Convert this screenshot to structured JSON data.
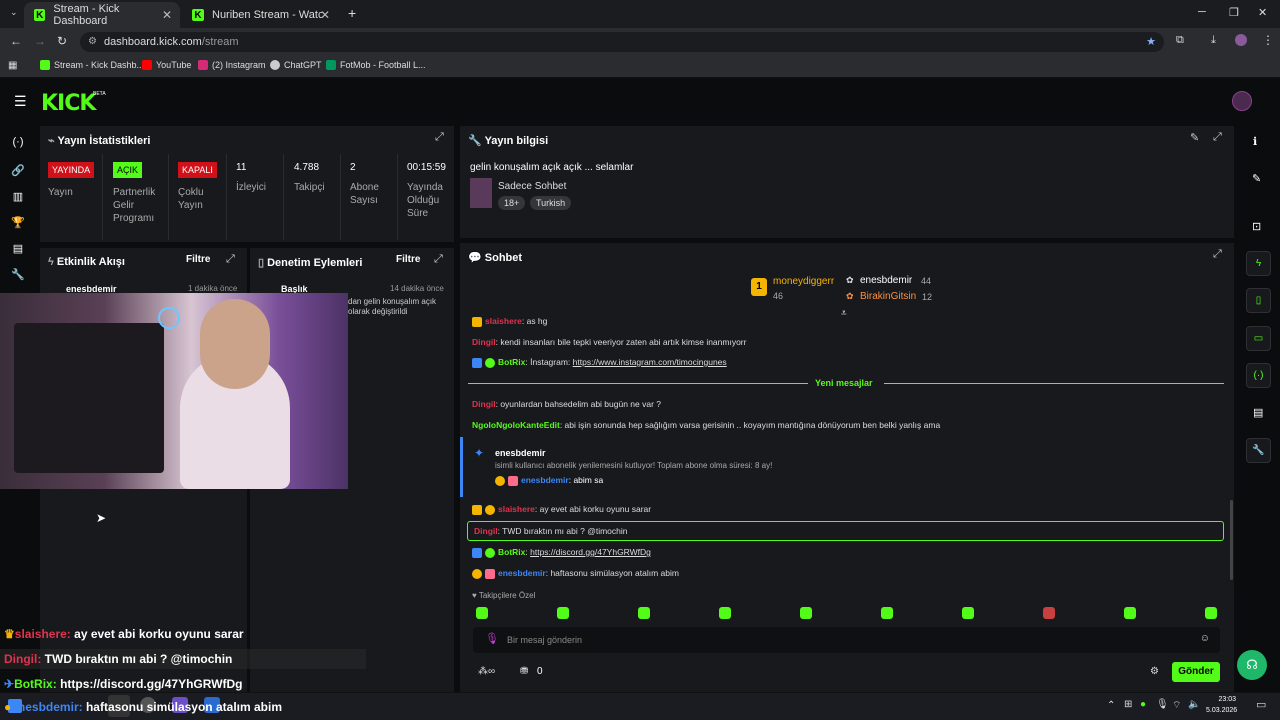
{
  "browser": {
    "tabs": [
      {
        "title": "Stream - Kick Dashboard"
      },
      {
        "title": "Nuriben Stream - Watch Live o"
      }
    ],
    "url_domain": "dashboard.kick.com",
    "url_path": "/stream",
    "bookmarks": [
      {
        "label": "Stream - Kick Dashb...",
        "icon": "kick-icon",
        "color": "#53fc18"
      },
      {
        "label": "YouTube",
        "icon": "youtube-icon",
        "color": "#ff0000"
      },
      {
        "label": "(2) Instagram",
        "icon": "instagram-icon",
        "color": "#d62976"
      },
      {
        "label": "ChatGPT",
        "icon": "chatgpt-icon",
        "color": "#cccccc"
      },
      {
        "label": "FotMob - Football L...",
        "icon": "fotmob-icon",
        "color": "#00985f"
      }
    ]
  },
  "kick": {
    "logo": "KICK",
    "beta": "BETA"
  },
  "stats": {
    "title": "Yayın İstatistikleri",
    "live_badge": "YAYINDA",
    "live_label": "Yayın",
    "partner_badge": "AÇIK",
    "partner_label_1": "Partnerlik",
    "partner_label_2": "Gelir",
    "partner_label_3": "Programı",
    "multi_badge": "KAPALI",
    "multi_label_1": "Çoklu",
    "multi_label_2": "Yayın",
    "viewers_val": "11",
    "viewers_label": "İzleyici",
    "followers_val": "4.788",
    "followers_label": "Takipçi",
    "subs_val": "2",
    "subs_label_1": "Abone",
    "subs_label_2": "Sayısı",
    "uptime_val": "00:15:59",
    "uptime_label_1": "Yayında",
    "uptime_label_2": "Olduğu",
    "uptime_label_3": "Süre"
  },
  "activity": {
    "title": "Etkinlik Akışı",
    "filter": "Filtre",
    "user": "enesbdemir",
    "time": "1 dakika önce"
  },
  "moderation": {
    "title": "Denetim Eylemleri",
    "filter": "Filtre",
    "item_title": "Başlık",
    "time": "14 dakika önce",
    "desc_1": "dan gelin konuşalım açık",
    "desc_2": "olarak değiştirildi"
  },
  "info": {
    "title": "Yayın bilgisi",
    "stream_title": "gelin konuşalım açık açık ... selamlar",
    "category": "Sadece Sohbet",
    "tag_age": "18+",
    "tag_lang": "Turkish"
  },
  "chat": {
    "title": "Sohbet",
    "top1_name": "moneydiggerr",
    "top1_val": "46",
    "top2_name": "enesbdemir",
    "top2_val": "44",
    "top3_name": "BirakinGitsin",
    "top3_val": "12",
    "l0_user": "slaishere",
    "l0_text": ": as hg",
    "l1_user": "Dingil",
    "l1_text": ": kendi insanları bile tepki veeriyor zaten abi artık kimse inanmıyorr",
    "l2_user": "BotRix",
    "l2_text": ": İnstagram: ",
    "l2_link": "https://www.instagram.com/timocingunes",
    "new_msgs": "Yeni mesajlar",
    "l3_user": "Dingil",
    "l3_text": ": oyunlardan bahsedelim abi bugün ne var ?",
    "l4_user": "NgoloNgoloKanteEdit",
    "l4_text": ": abi işin sonunda hep sağlığım varsa gerisinin .. koyayım mantığına dönüyorum ben belki yanlış ama",
    "sub_user": "enesbdemir",
    "sub_text": "isimli kullanıcı abonelik yenilemesini kutluyor! Toplam abone olma süresi: 8 ay!",
    "sub_reply_user": "enesbdemir",
    "sub_reply_text": ": abim sa",
    "l5_user": "slaishere",
    "l5_text": ": ay evet abi korku oyunu sarar",
    "l6_user": "Dingil",
    "l6_text": ": TWD bıraktın mı abi ? @timochin",
    "l7_user": "BotRix",
    "l7_text": ": ",
    "l7_link": "https://discord.gg/47YhGRWfDg",
    "l8_user": "enesbdemir",
    "l8_text": ": haftasonu simülasyon atalım abim",
    "emote_section": "Takipçilere Özel",
    "input_placeholder": "Bir mesaj gönderin",
    "points": "0",
    "send": "Gönder"
  },
  "overlay": {
    "o1_user": "slaishere:",
    "o1_text": " ay evet abi korku oyunu sarar",
    "o2_user": "Dingil:",
    "o2_text": " TWD bıraktın mı abi ? @timochin",
    "o3_user": "BotRix:",
    "o3_text": " https://discord.gg/47YhGRWfDg",
    "o4_user": "enesbdemir:",
    "o4_text": " haftasonu simülasyon atalım abim"
  },
  "taskbar": {
    "time": "23:03",
    "date": "5.03.2026"
  }
}
